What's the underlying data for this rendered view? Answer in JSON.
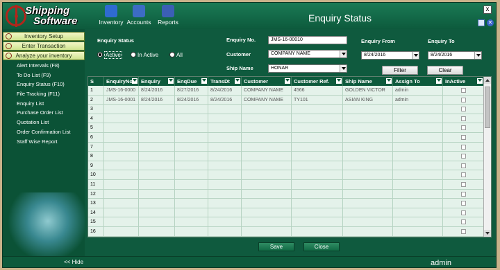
{
  "app": {
    "logo_line1": "Shipping",
    "logo_line2": "Software",
    "title": "Enquiry Status",
    "close_label": "x"
  },
  "toolbar": [
    {
      "label": "Inventory",
      "color": "#2f6bd1"
    },
    {
      "label": "Accounts",
      "color": "#3c6cc4"
    },
    {
      "label": "Reports",
      "color": "#3b5fb5"
    }
  ],
  "sidebar": {
    "buttons": [
      "Inventory Setup",
      "Enter Transaction",
      "Analyze your inventory"
    ],
    "items": [
      "Alert Intervals (F8)",
      "To Do List (F9)",
      "Enquiry Status (F10)",
      "File Tracking (F11)",
      "Enquiry List",
      "Purchase Order List",
      "Quotation List",
      "Order Confirmation List",
      "Staff Wise Report"
    ],
    "hide_label": "<< Hide"
  },
  "filters": {
    "status_label": "Enquiry Status",
    "radios": [
      {
        "label": "Active",
        "selected": true
      },
      {
        "label": "In Active",
        "selected": false
      },
      {
        "label": "All",
        "selected": false
      }
    ],
    "enquiry_no_label": "Enquiry No.",
    "enquiry_no_value": "JMS-16-00010",
    "customer_label": "Customer",
    "customer_value": "COMPANY NAME",
    "ship_name_label": "Ship Name",
    "ship_name_value": "HONAR",
    "from_label": "Enquiry From",
    "from_value": "8/24/2016",
    "to_label": "Enquiry To",
    "to_value": "8/24/2016",
    "filter_button": "Filter",
    "clear_button": "Clear"
  },
  "grid": {
    "columns": [
      "S",
      "EnquiryNo",
      "Enquiry",
      "EnqDue",
      "TransDt",
      "Customer",
      "Customer Ref.",
      "Ship Name",
      "Assign To",
      "InActive"
    ],
    "rows": [
      [
        "1",
        "JMS-16-0000",
        "8/24/2016",
        "8/27/2016",
        "8/24/2016",
        "COMPANY NAME",
        "4566",
        "GOLDEN VICTOR",
        "admin",
        ""
      ],
      [
        "2",
        "JMS-16-0001",
        "8/24/2016",
        "8/24/2016",
        "8/24/2016",
        "COMPANY NAME",
        "TY101",
        "ASIAN KING",
        "admin",
        ""
      ],
      [
        "3",
        "",
        "",
        "",
        "",
        "",
        "",
        "",
        "",
        ""
      ],
      [
        "4",
        "",
        "",
        "",
        "",
        "",
        "",
        "",
        "",
        ""
      ],
      [
        "5",
        "",
        "",
        "",
        "",
        "",
        "",
        "",
        "",
        ""
      ],
      [
        "6",
        "",
        "",
        "",
        "",
        "",
        "",
        "",
        "",
        ""
      ],
      [
        "7",
        "",
        "",
        "",
        "",
        "",
        "",
        "",
        "",
        ""
      ],
      [
        "8",
        "",
        "",
        "",
        "",
        "",
        "",
        "",
        "",
        ""
      ],
      [
        "9",
        "",
        "",
        "",
        "",
        "",
        "",
        "",
        "",
        ""
      ],
      [
        "10",
        "",
        "",
        "",
        "",
        "",
        "",
        "",
        "",
        ""
      ],
      [
        "11",
        "",
        "",
        "",
        "",
        "",
        "",
        "",
        "",
        ""
      ],
      [
        "12",
        "",
        "",
        "",
        "",
        "",
        "",
        "",
        "",
        ""
      ],
      [
        "13",
        "",
        "",
        "",
        "",
        "",
        "",
        "",
        "",
        ""
      ],
      [
        "14",
        "",
        "",
        "",
        "",
        "",
        "",
        "",
        "",
        ""
      ],
      [
        "15",
        "",
        "",
        "",
        "",
        "",
        "",
        "",
        "",
        ""
      ],
      [
        "16",
        "",
        "",
        "",
        "",
        "",
        "",
        "",
        "",
        ""
      ]
    ]
  },
  "footer": {
    "save_button": "Save",
    "close_button": "Close",
    "user": "admin"
  }
}
